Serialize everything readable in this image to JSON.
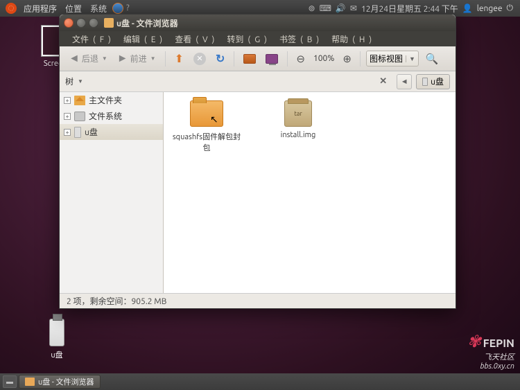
{
  "top_panel": {
    "menus": [
      "应用程序",
      "位置",
      "系统"
    ],
    "datetime": "12月24日星期五  2:44 下午",
    "username": "lengee"
  },
  "desktop": {
    "screenshot_label": "Screens",
    "usb_label": "u盘"
  },
  "window": {
    "title": "u盘 - 文件浏览器",
    "menus": [
      {
        "label": "文件",
        "key": "F"
      },
      {
        "label": "编辑",
        "key": "E"
      },
      {
        "label": "查看",
        "key": "V"
      },
      {
        "label": "转到",
        "key": "G"
      },
      {
        "label": "书签",
        "key": "B"
      },
      {
        "label": "帮助",
        "key": "H"
      }
    ],
    "toolbar": {
      "back": "后退",
      "forward": "前进",
      "zoom_level": "100%",
      "view_mode": "图标视图"
    },
    "sidebar": {
      "header": "树",
      "items": [
        {
          "label": "主文件夹",
          "icon": "home"
        },
        {
          "label": "文件系统",
          "icon": "fs"
        },
        {
          "label": "u盘",
          "icon": "usb",
          "selected": true
        }
      ]
    },
    "path": {
      "current": "u盘"
    },
    "files": [
      {
        "name": "squashfs固件解包封包",
        "type": "folder"
      },
      {
        "name": "install.img",
        "type": "archive",
        "badge": "tar"
      }
    ],
    "status": "2 项，剩余空间：905.2 MB"
  },
  "taskbar": {
    "task_title": "u盘 - 文件浏览器"
  },
  "watermark": {
    "brand": "FEPIN",
    "sub": "飞天社区",
    "url": "bbs.0xy.cn"
  }
}
